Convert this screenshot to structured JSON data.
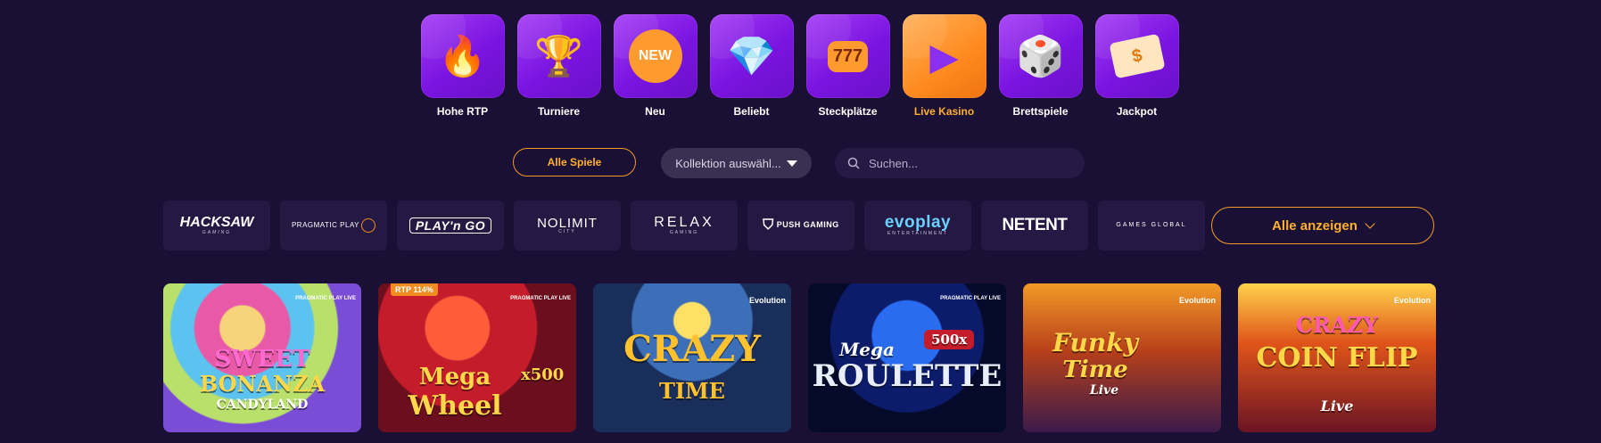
{
  "categories": [
    {
      "label": "Hohe RTP",
      "icon": "flame-icon",
      "active": false,
      "glyph": "🔥"
    },
    {
      "label": "Turniere",
      "icon": "trophy-icon",
      "active": false,
      "glyph": "🏆"
    },
    {
      "label": "Neu",
      "icon": "new-badge-icon",
      "active": false,
      "glyph": "NEW"
    },
    {
      "label": "Beliebt",
      "icon": "diamond-icon",
      "active": false,
      "glyph": "💎"
    },
    {
      "label": "Steckplätze",
      "icon": "slot-777-icon",
      "active": false,
      "glyph": "777"
    },
    {
      "label": "Live Kasino",
      "icon": "play-icon",
      "active": true,
      "glyph": "▶"
    },
    {
      "label": "Brettspiele",
      "icon": "dice-icon",
      "active": false,
      "glyph": "🎲"
    },
    {
      "label": "Jackpot",
      "icon": "money-icon",
      "active": false,
      "glyph": "$"
    }
  ],
  "filters": {
    "all_games_label": "Alle Spiele",
    "collection_value": "Kollektion auswähl...",
    "search_placeholder": "Suchen..."
  },
  "providers": [
    {
      "name": "HACKSAW",
      "sub": "GAMING"
    },
    {
      "name": "PRAGMATIC PLAY"
    },
    {
      "name": "PLAY'n GO"
    },
    {
      "name": "NOLIMIT",
      "sub": "CITY"
    },
    {
      "name": "RELAX",
      "sub": "GAMING"
    },
    {
      "name": "PUSH GAMING"
    },
    {
      "name": "evoplay",
      "sub": "ENTERTAINMENT"
    },
    {
      "name": "NETENT"
    },
    {
      "name": "GAMES GLOBAL"
    }
  ],
  "show_all_label": "Alle anzeigen",
  "games": [
    {
      "title": "Sweet Bonanza Candyland",
      "provider": "PRAGMATIC PLAY LIVE",
      "line1": "SWEET",
      "line2": "BONANZA",
      "line3": "CANDYLAND"
    },
    {
      "title": "Mega Wheel",
      "provider": "PRAGMATIC PLAY LIVE",
      "badge": "RTP 114%",
      "line1": "Mega",
      "line2": "Wheel",
      "line3": "x500"
    },
    {
      "title": "Crazy Time",
      "provider": "Evolution",
      "line1": "CRAZY",
      "line2": "TIME"
    },
    {
      "title": "Mega Roulette",
      "provider": "PRAGMATIC PLAY LIVE",
      "line1": "Mega",
      "line2": "ROULETTE",
      "line3": "500x"
    },
    {
      "title": "Funky Time",
      "provider": "Evolution",
      "line1": "Funky",
      "line2": "Time",
      "line3": "Live"
    },
    {
      "title": "Crazy Coin Flip",
      "provider": "Evolution",
      "line1": "CRAZY",
      "line2": "COIN FLIP",
      "line3": "Live"
    }
  ]
}
